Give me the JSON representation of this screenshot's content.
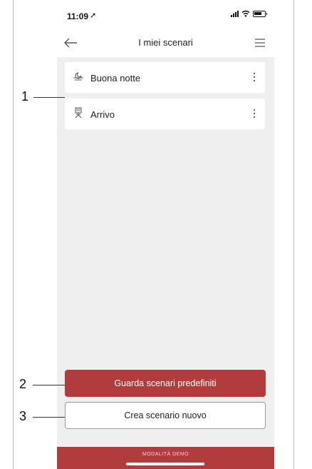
{
  "status_bar": {
    "time": "11:09",
    "location_glyph": "➚"
  },
  "nav": {
    "title": "I miei scenari",
    "back_icon": "arrow-left-icon",
    "menu_icon": "hamburger-menu-icon"
  },
  "scenarios": [
    {
      "label": "Buona notte",
      "icon": "moon-horizon-icon"
    },
    {
      "label": "Arrivo",
      "icon": "arrival-person-icon"
    }
  ],
  "buttons": {
    "view_presets": "Guarda scenari predefiniti",
    "create_new": "Crea scenario nuovo"
  },
  "footer": {
    "demo_mode": "MODALITÀ DEMO"
  },
  "callouts": [
    "1",
    "2",
    "3"
  ],
  "colors": {
    "accent": "#b23b3d",
    "background": "#efefef",
    "card": "#ffffff"
  }
}
